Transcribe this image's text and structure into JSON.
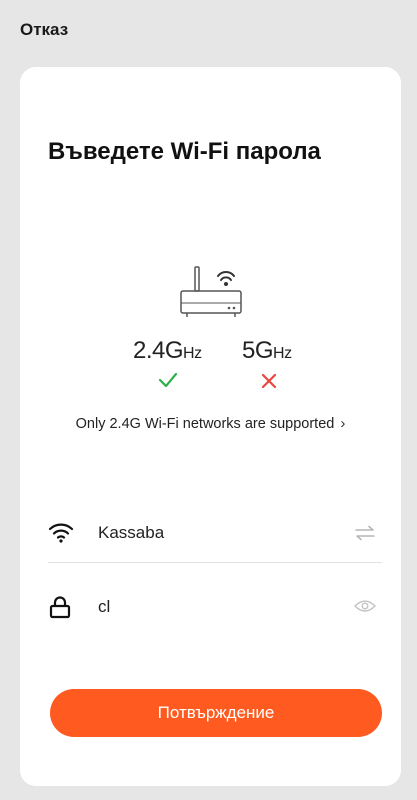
{
  "header": {
    "cancel_label": "Отказ"
  },
  "main": {
    "title": "Въведете Wi-Fi парола",
    "bands": [
      {
        "main": "2.4G",
        "unit": "Hz",
        "supported": true
      },
      {
        "main": "5G",
        "unit": "Hz",
        "supported": false
      }
    ],
    "support_note": "Only 2.4G Wi-Fi networks are supported",
    "support_chevron": "›"
  },
  "form": {
    "network_name": "Kassaba",
    "password_value": "cl"
  },
  "footer": {
    "confirm_label": "Потвърждение"
  },
  "icons": {
    "wifi": "wifi-icon",
    "lock": "lock-icon",
    "switch": "switch-network-icon",
    "eye": "eye-icon",
    "check": "check-icon",
    "cross": "cross-icon",
    "router": "router-icon"
  },
  "colors": {
    "accent": "#ff5a1f",
    "check": "#2fb04a",
    "cross": "#e5493f",
    "background": "#e6e6e6"
  }
}
